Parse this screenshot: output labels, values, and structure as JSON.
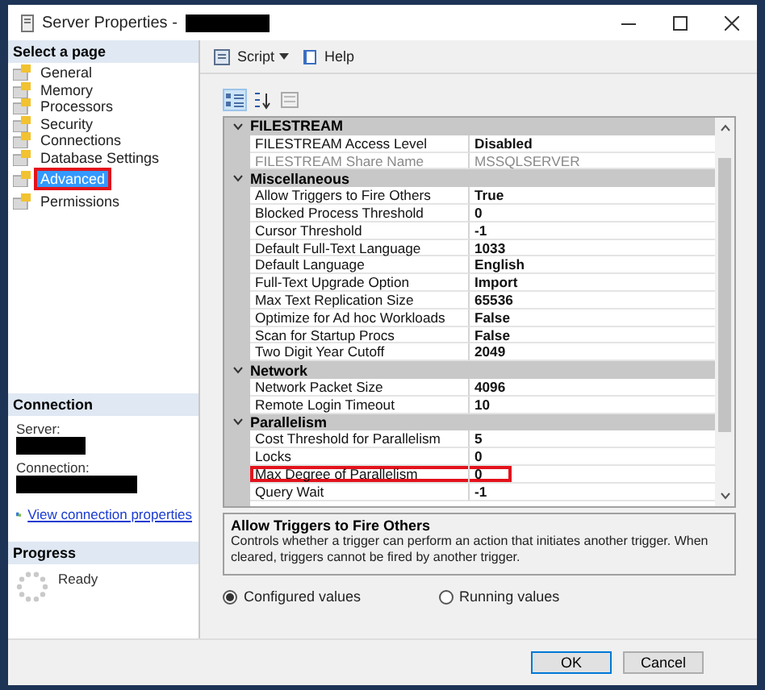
{
  "window": {
    "title": "Server Properties -"
  },
  "sidebar": {
    "header": "Select a page",
    "items": [
      {
        "label": "General",
        "selected": false,
        "highlighted": false
      },
      {
        "label": "Memory",
        "selected": false,
        "highlighted": false
      },
      {
        "label": "Processors",
        "selected": false,
        "highlighted": false
      },
      {
        "label": "Security",
        "selected": false,
        "highlighted": false
      },
      {
        "label": "Connections",
        "selected": false,
        "highlighted": false
      },
      {
        "label": "Database Settings",
        "selected": false,
        "highlighted": false
      },
      {
        "label": "Advanced",
        "selected": true,
        "highlighted": true
      },
      {
        "label": "Permissions",
        "selected": false,
        "highlighted": false
      }
    ]
  },
  "connection": {
    "header": "Connection",
    "server_label": "Server:",
    "connection_label": "Connection:",
    "link": "View connection properties"
  },
  "progress": {
    "header": "Progress",
    "status": "Ready"
  },
  "toolbar": {
    "script": "Script",
    "help": "Help"
  },
  "grid": {
    "categories": [
      {
        "name": "FILESTREAM",
        "expanded": true,
        "properties": [
          {
            "name": "FILESTREAM Access Level",
            "value": "Disabled",
            "disabled": false,
            "highlighted": false
          },
          {
            "name": "FILESTREAM Share Name",
            "value": "MSSQLSERVER",
            "disabled": true,
            "highlighted": false
          }
        ]
      },
      {
        "name": "Miscellaneous",
        "expanded": true,
        "properties": [
          {
            "name": "Allow Triggers to Fire Others",
            "value": "True",
            "disabled": false,
            "highlighted": false
          },
          {
            "name": "Blocked Process Threshold",
            "value": "0",
            "disabled": false,
            "highlighted": false
          },
          {
            "name": "Cursor Threshold",
            "value": "-1",
            "disabled": false,
            "highlighted": false
          },
          {
            "name": "Default Full-Text Language",
            "value": "1033",
            "disabled": false,
            "highlighted": false
          },
          {
            "name": "Default Language",
            "value": "English",
            "disabled": false,
            "highlighted": false
          },
          {
            "name": "Full-Text Upgrade Option",
            "value": "Import",
            "disabled": false,
            "highlighted": false
          },
          {
            "name": "Max Text Replication Size",
            "value": "65536",
            "disabled": false,
            "highlighted": false
          },
          {
            "name": "Optimize for Ad hoc Workloads",
            "value": "False",
            "disabled": false,
            "highlighted": false
          },
          {
            "name": "Scan for Startup Procs",
            "value": "False",
            "disabled": false,
            "highlighted": false
          },
          {
            "name": "Two Digit Year Cutoff",
            "value": "2049",
            "disabled": false,
            "highlighted": false
          }
        ]
      },
      {
        "name": "Network",
        "expanded": true,
        "properties": [
          {
            "name": "Network Packet Size",
            "value": "4096",
            "disabled": false,
            "highlighted": false
          },
          {
            "name": "Remote Login Timeout",
            "value": "10",
            "disabled": false,
            "highlighted": false
          }
        ]
      },
      {
        "name": "Parallelism",
        "expanded": true,
        "properties": [
          {
            "name": "Cost Threshold for Parallelism",
            "value": "5",
            "disabled": false,
            "highlighted": false
          },
          {
            "name": "Locks",
            "value": "0",
            "disabled": false,
            "highlighted": false
          },
          {
            "name": "Max Degree of Parallelism",
            "value": "0",
            "disabled": false,
            "highlighted": true
          },
          {
            "name": "Query Wait",
            "value": "-1",
            "disabled": false,
            "highlighted": false
          }
        ]
      }
    ]
  },
  "description": {
    "title": "Allow Triggers to Fire Others",
    "text": "Controls whether a trigger can perform an action that initiates another trigger. When cleared, triggers cannot be fired by another trigger."
  },
  "value_mode": [
    {
      "label": "Configured values",
      "selected": true
    },
    {
      "label": "Running values",
      "selected": false
    }
  ],
  "buttons": [
    {
      "label": "OK",
      "default": true
    },
    {
      "label": "Cancel",
      "default": false
    }
  ]
}
